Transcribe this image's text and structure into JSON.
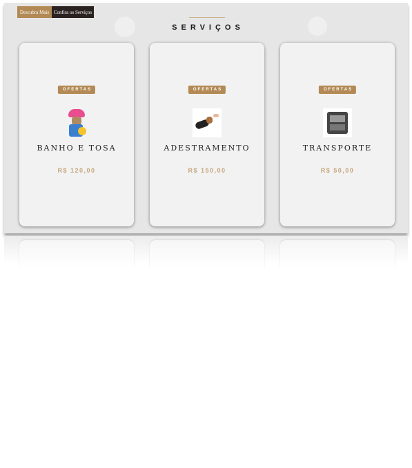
{
  "header": {
    "discover_label": "Descubra Mais",
    "services_label": "Confira os Serviços",
    "title": "SERVIÇOS"
  },
  "colors": {
    "accent": "#b38a55",
    "dark": "#2a2220",
    "price": "#c6a57a"
  },
  "cards": [
    {
      "badge": "OFERTAS",
      "name": "BANHO E TOSA",
      "price": "R$ 120,00",
      "image": "dog-in-bath-cap"
    },
    {
      "badge": "OFERTAS",
      "name": "ADESTRAMENTO",
      "price": "R$ 150,00",
      "image": "dog-high-five"
    },
    {
      "badge": "OFERTAS",
      "name": "TRANSPORTE",
      "price": "R$ 50,00",
      "image": "pet-transport-van"
    }
  ]
}
